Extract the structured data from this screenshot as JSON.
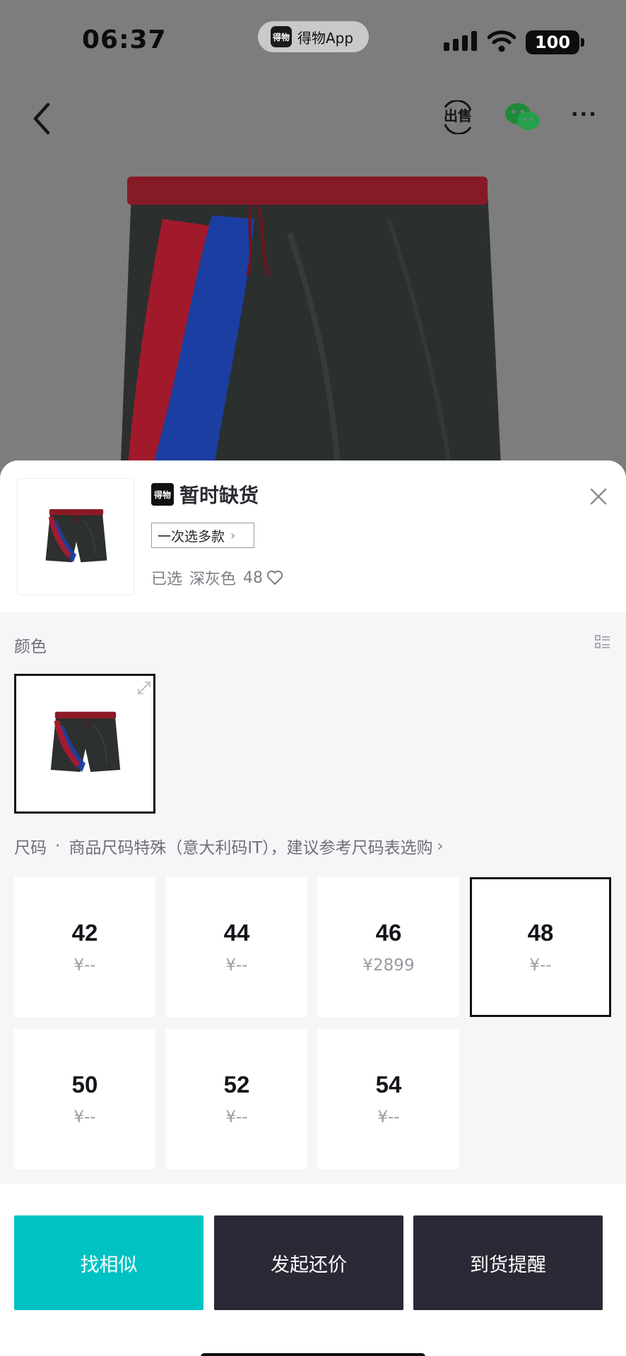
{
  "status_bar": {
    "time": "06:37",
    "app_name": "得物App",
    "app_logo_text": "得物",
    "battery": "100"
  },
  "nav": {
    "sell_label": "出售"
  },
  "sheet": {
    "brand_logo_text": "得物",
    "stock_status": "暂时缺货",
    "multi_select_label": "一次选多款",
    "selected_prefix": "已选",
    "selected_color": "深灰色",
    "selected_size": "48",
    "color_section_label": "颜色",
    "size_section_label": "尺码",
    "size_note": "商品尺码特殊（意大利码IT），建议参考尺码表选购",
    "sizes": [
      {
        "size": "42",
        "price": "¥--"
      },
      {
        "size": "44",
        "price": "¥--"
      },
      {
        "size": "46",
        "price": "¥2899"
      },
      {
        "size": "48",
        "price": "¥--"
      },
      {
        "size": "50",
        "price": "¥--"
      },
      {
        "size": "52",
        "price": "¥--"
      },
      {
        "size": "54",
        "price": "¥--"
      }
    ],
    "selected_size_index": 3
  },
  "actions": {
    "similar": "找相似",
    "bargain": "发起还价",
    "notify": "到货提醒"
  },
  "colors": {
    "accent_teal": "#01c2c3",
    "dark_button": "#2a2a36",
    "shorts_body": "#2c302f",
    "shorts_waist": "#8c1a26",
    "stripe_red": "#a61a2e",
    "stripe_blue": "#1d3fa0"
  }
}
